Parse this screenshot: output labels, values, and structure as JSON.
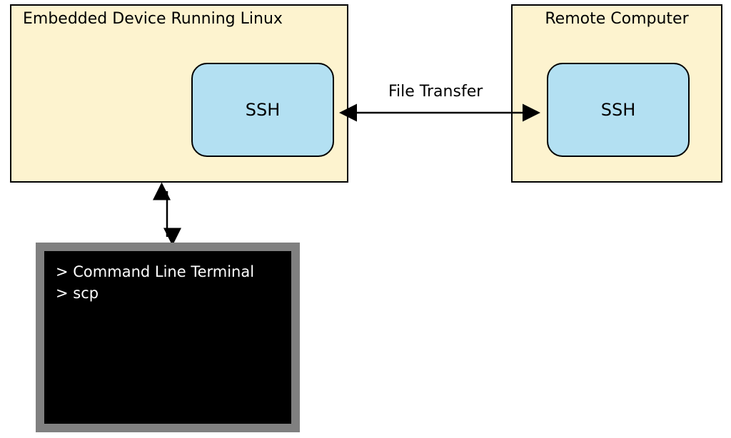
{
  "embedded_device": {
    "title": "Embedded Device Running Linux",
    "ssh_label": "SSH"
  },
  "remote_computer": {
    "title": "Remote Computer",
    "ssh_label": "SSH"
  },
  "connection": {
    "label": "File Transfer"
  },
  "terminal": {
    "line1": "> Command Line Terminal",
    "line2": "> scp"
  }
}
